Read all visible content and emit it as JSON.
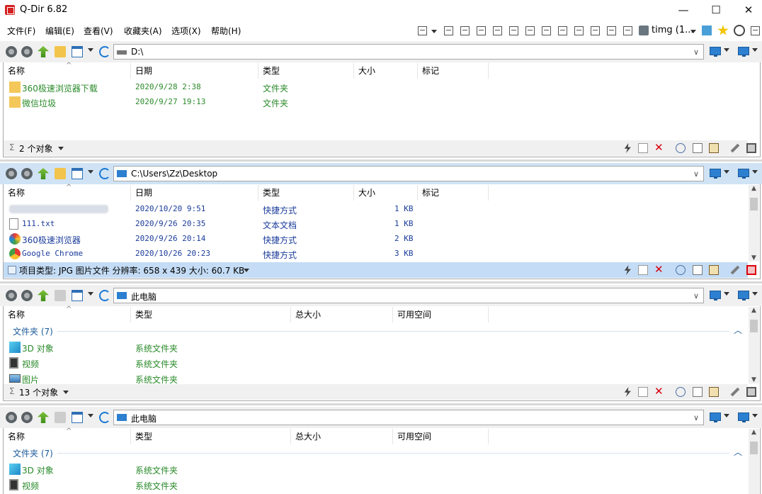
{
  "window": {
    "title": "Q-Dir 6.82",
    "controls": {
      "minimize": "—",
      "maximize": "☐",
      "close": "✕"
    }
  },
  "menu": [
    "文件(F)",
    "编辑(E)",
    "查看(V)",
    "收藏夹(A)",
    "选项(X)",
    "帮助(H)"
  ],
  "toolbar": {
    "profile_label": "timg (1..."
  },
  "headers_files": {
    "name": "名称",
    "date": "日期",
    "type": "类型",
    "size": "大小",
    "tag": "标记"
  },
  "headers_pc": {
    "name": "名称",
    "type": "类型",
    "total": "总大小",
    "free": "可用空间"
  },
  "pane1": {
    "path": "D:\\",
    "rows": [
      {
        "name": "360极速浏览器下载",
        "date": "2020/9/28 2:38",
        "type": "文件夹"
      },
      {
        "name": "微信垃圾",
        "date": "2020/9/27 19:13",
        "type": "文件夹"
      }
    ],
    "status": "2 个对象"
  },
  "pane2": {
    "path": "C:\\Users\\Zz\\Desktop",
    "rows": [
      {
        "name": "",
        "date": "2020/10/20 9:51",
        "type": "快捷方式",
        "size": "1 KB",
        "icon": "blurred-icon"
      },
      {
        "name": "111.txt",
        "date": "2020/9/26 20:35",
        "type": "文本文档",
        "size": "1 KB",
        "icon": "text-file-icon"
      },
      {
        "name": "360极速浏览器",
        "date": "2020/9/26 20:14",
        "type": "快捷方式",
        "size": "2 KB",
        "icon": "browser-icon"
      },
      {
        "name": "Google Chrome",
        "date": "2020/10/26 20:23",
        "type": "快捷方式",
        "size": "3 KB",
        "icon": "chrome-icon"
      }
    ],
    "status": "项目类型: JPG 图片文件 分辨率: 658 x 439 大小: 60.7 KB"
  },
  "pane3": {
    "path": "此电脑",
    "group": "文件夹 (7)",
    "rows": [
      {
        "name": "3D 对象",
        "type": "系统文件夹"
      },
      {
        "name": "视频",
        "type": "系统文件夹"
      },
      {
        "name": "图片",
        "type": "系统文件夹"
      }
    ],
    "status": "13 个对象"
  },
  "pane4": {
    "path": "此电脑",
    "group": "文件夹 (7)",
    "rows": [
      {
        "name": "3D 对象",
        "type": "系统文件夹"
      },
      {
        "name": "视频",
        "type": "系统文件夹"
      }
    ]
  },
  "colors": {
    "active_pane": "#cfe3f5",
    "folder_name": "#2a8a2a",
    "file_name": "#1b3c9a",
    "delete": "#d9000e"
  }
}
